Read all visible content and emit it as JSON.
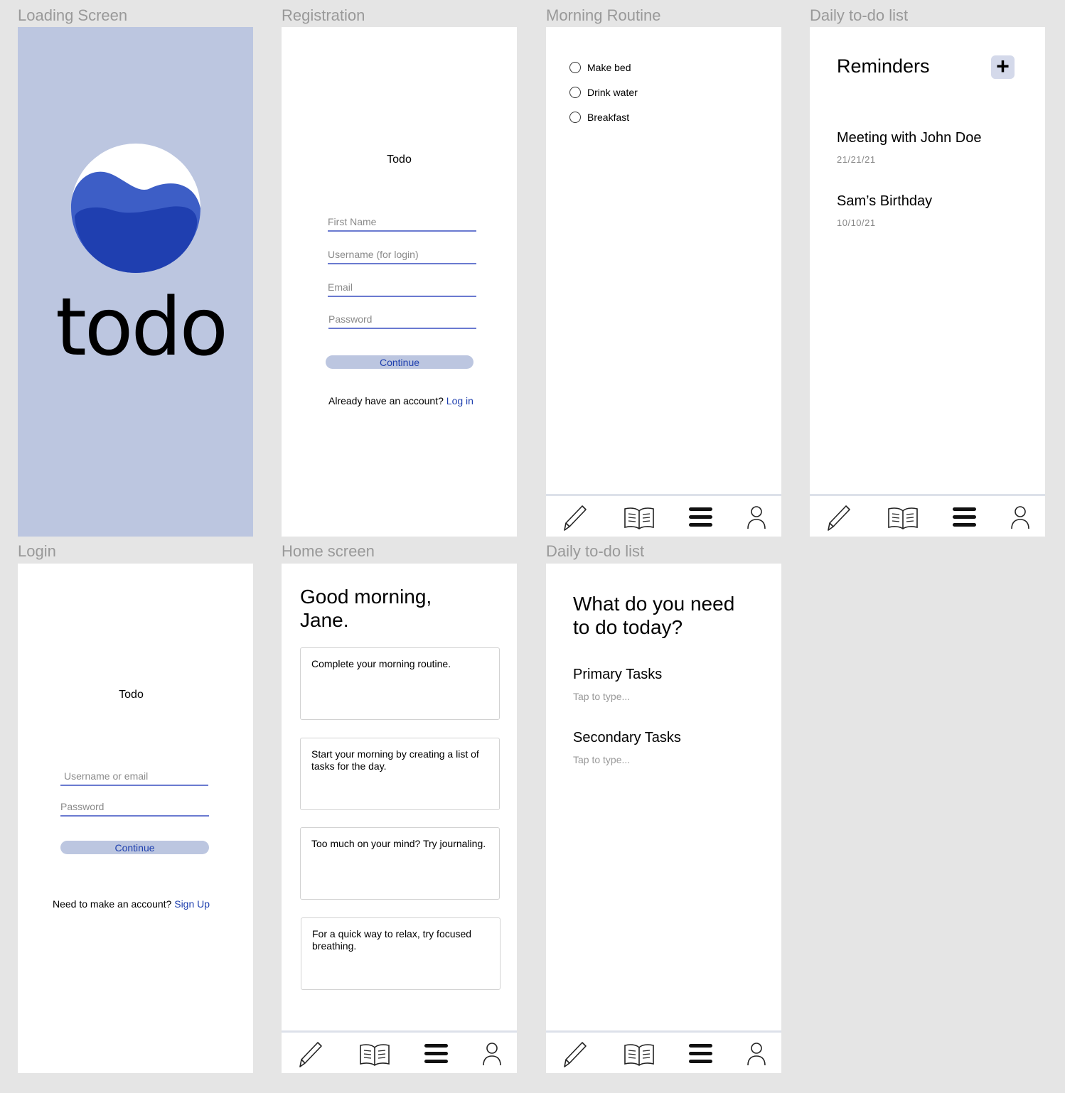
{
  "frames": {
    "loading": {
      "title": "Loading Screen",
      "logo_text": "todo",
      "logo_colors": [
        "#ffffff",
        "#3a5bc7",
        "#1e3fae"
      ],
      "bg": "#bcc6e0"
    },
    "registration": {
      "title": "Registration",
      "app_title": "Todo",
      "fields": [
        "First Name",
        "Username (for login)",
        "Email",
        "Password"
      ],
      "continue": "Continue",
      "footer_text": "Already have an account?",
      "footer_link": "Log in"
    },
    "morning": {
      "title": "Morning Routine",
      "items": [
        "Make bed",
        "Drink water",
        "Breakfast"
      ]
    },
    "reminders": {
      "title": "Daily to-do list",
      "heading": "Reminders",
      "add_icon": "+",
      "items": [
        {
          "title": "Meeting with John Doe",
          "date": "21/21/21"
        },
        {
          "title": "Sam’s Birthday",
          "date": "10/10/21"
        }
      ]
    },
    "login": {
      "title": "Login",
      "app_title": "Todo",
      "fields": [
        "Username or email",
        "Password"
      ],
      "continue": "Continue",
      "footer_text": "Need to make an account?",
      "footer_link": "Sign Up"
    },
    "home": {
      "title": "Home screen",
      "greeting_line1": "Good morning,",
      "greeting_line2": "Jane.",
      "cards": [
        "Complete your morning routine.",
        "Start your morning by creating a list of tasks for the day.",
        "Too much on your mind? Try journaling.",
        "For a quick way to relax, try focused breathing."
      ]
    },
    "daily": {
      "title": "Daily to-do list",
      "question_line1": "What do you need",
      "question_line2": "to do today?",
      "primary": "Primary Tasks",
      "primary_placeholder": "Tap to type...",
      "secondary": "Secondary Tasks",
      "secondary_placeholder": "Tap to type..."
    }
  },
  "nav_icons": [
    "pencil-icon",
    "book-icon",
    "menu-icon",
    "profile-icon"
  ],
  "colors": {
    "accent": "#1e3fae",
    "field_line": "#6a7ad0",
    "button_bg": "#bcc6e0"
  }
}
